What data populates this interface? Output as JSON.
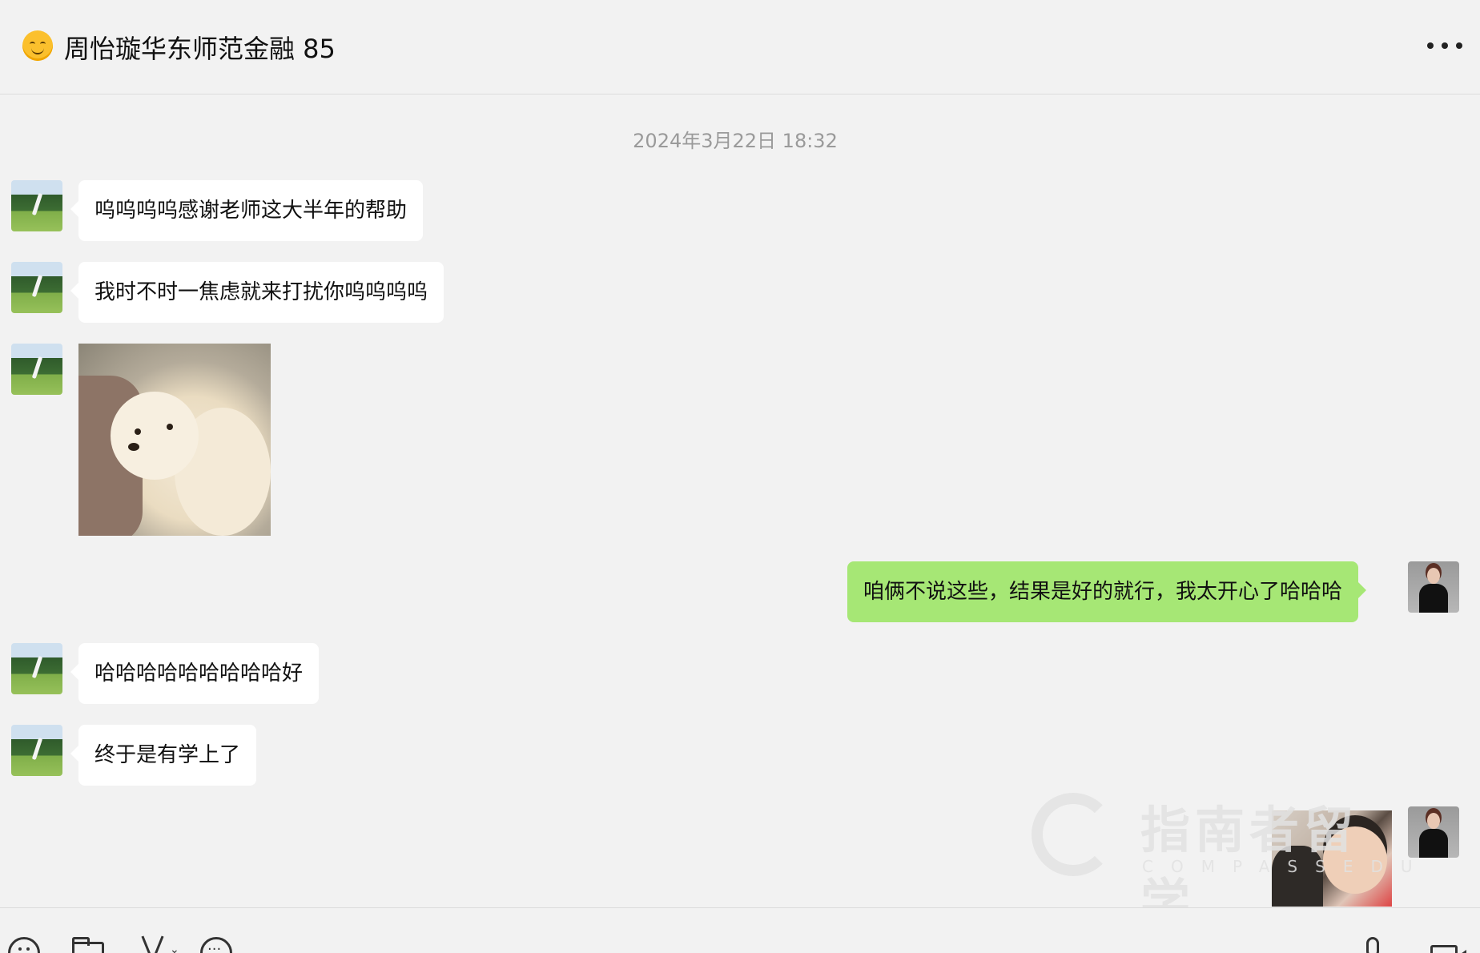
{
  "header": {
    "emoji_icon": "smiling-face-icon",
    "title": "周怡璇华东师范金融 85",
    "more_icon": "more-dots-icon"
  },
  "chat": {
    "timestamp": "2024年3月22日 18:32",
    "messages": [
      {
        "side": "left",
        "type": "text",
        "text": "呜呜呜呜感谢老师这大半年的帮助"
      },
      {
        "side": "left",
        "type": "text",
        "text": "我时不时一焦虑就来打扰你呜呜呜呜"
      },
      {
        "side": "left",
        "type": "sticker",
        "sticker": "puppy-sticker"
      },
      {
        "side": "right",
        "type": "text",
        "text": "咱俩不说这些，结果是好的就行，我太开心了哈哈哈"
      },
      {
        "side": "left",
        "type": "text",
        "text": "哈哈哈哈哈哈哈哈哈好"
      },
      {
        "side": "left",
        "type": "text",
        "text": "终于是有学上了"
      },
      {
        "side": "right",
        "type": "sticker",
        "sticker": "kids-sticker"
      }
    ]
  },
  "watermark": {
    "cn": "指南者留学",
    "en": "COMPASSEDU"
  },
  "colors": {
    "background": "#f2f2f2",
    "bubble_in": "#ffffff",
    "bubble_out": "#a6e775",
    "timestamp": "#9a9a9a"
  },
  "toolbar": {
    "icons": [
      "emoji-icon",
      "folder-icon",
      "scissors-icon",
      "chevron-down-icon",
      "chat-history-icon",
      "microphone-icon",
      "video-call-icon"
    ]
  }
}
